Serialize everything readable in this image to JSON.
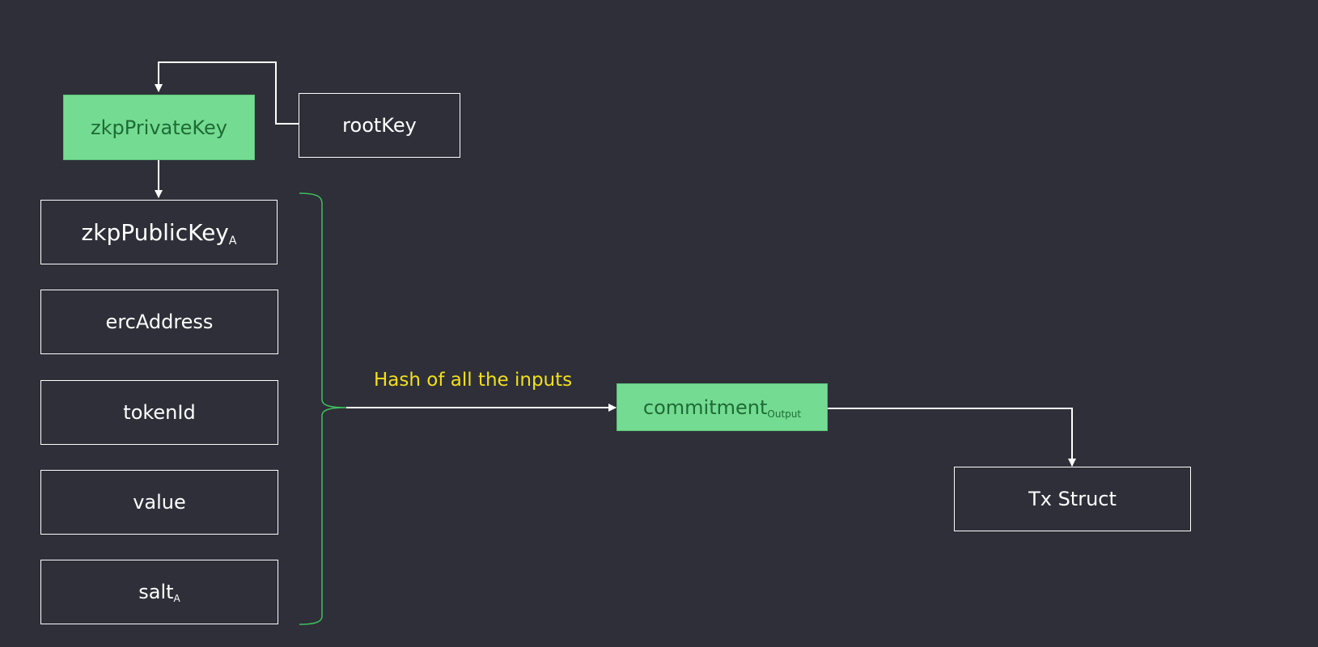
{
  "colors": {
    "background": "#2e2f38",
    "box_border": "#ffffff",
    "green_fill": "#74dc92",
    "green_text": "#1e6b35",
    "brace": "#3fbf5c",
    "hash_label": "#f2e01a"
  },
  "nodes": {
    "zkp_private_key": "zkpPrivateKey",
    "root_key": "rootKey",
    "zkp_public_key": {
      "main": "zkpPublicKey",
      "sub": "A"
    },
    "erc_address": "ercAddress",
    "token_id": "tokenId",
    "value": "value",
    "salt": {
      "main": "salt",
      "sub": "A"
    },
    "commitment": {
      "main": "commitment",
      "sub": "Output"
    },
    "tx_struct": "Tx Struct"
  },
  "hash_label": "Hash of all the inputs"
}
